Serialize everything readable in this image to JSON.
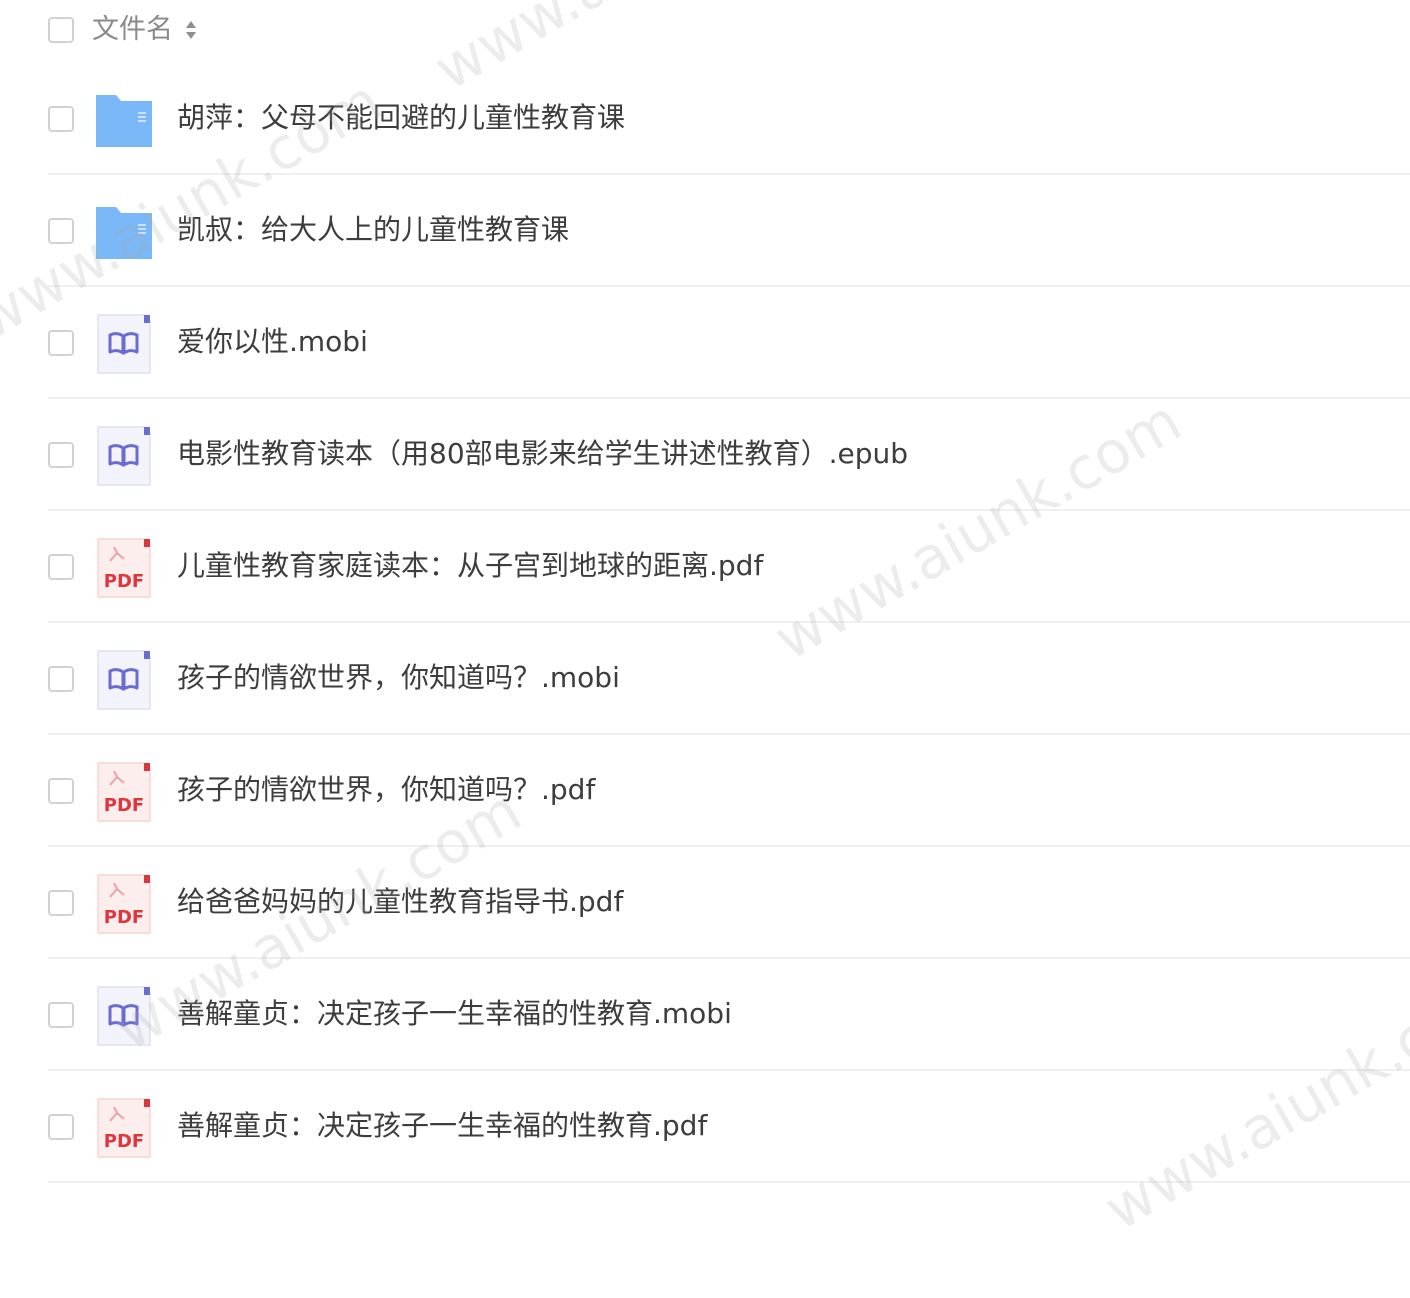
{
  "header": {
    "column_label": "文件名",
    "sort_icon": "sort-updown-icon"
  },
  "files": [
    {
      "name": "胡萍：父母不能回避的儿童性教育课",
      "type": "folder",
      "icon": "folder-icon"
    },
    {
      "name": "凯叔：给大人上的儿童性教育课",
      "type": "folder",
      "icon": "folder-icon"
    },
    {
      "name": "爱你以性.mobi",
      "type": "ebook",
      "icon": "ebook-icon"
    },
    {
      "name": "电影性教育读本（用80部电影来给学生讲述性教育）.epub",
      "type": "ebook",
      "icon": "ebook-icon"
    },
    {
      "name": "儿童性教育家庭读本：从子宫到地球的距离.pdf",
      "type": "pdf",
      "icon": "pdf-icon",
      "icon_text": "PDF"
    },
    {
      "name": "孩子的情欲世界，你知道吗？.mobi",
      "type": "ebook",
      "icon": "ebook-icon"
    },
    {
      "name": "孩子的情欲世界，你知道吗？.pdf",
      "type": "pdf",
      "icon": "pdf-icon",
      "icon_text": "PDF"
    },
    {
      "name": "给爸爸妈妈的儿童性教育指导书.pdf",
      "type": "pdf",
      "icon": "pdf-icon",
      "icon_text": "PDF"
    },
    {
      "name": "善解童贞：决定孩子一生幸福的性教育.mobi",
      "type": "ebook",
      "icon": "ebook-icon"
    },
    {
      "name": "善解童贞：决定孩子一生幸福的性教育.pdf",
      "type": "pdf",
      "icon": "pdf-icon",
      "icon_text": "PDF"
    }
  ],
  "watermark": {
    "text": "www.aiunk.com"
  },
  "colors": {
    "folder": "#5aa5f5",
    "ebook": "#6b6bd6",
    "pdf": "#e0353b"
  }
}
